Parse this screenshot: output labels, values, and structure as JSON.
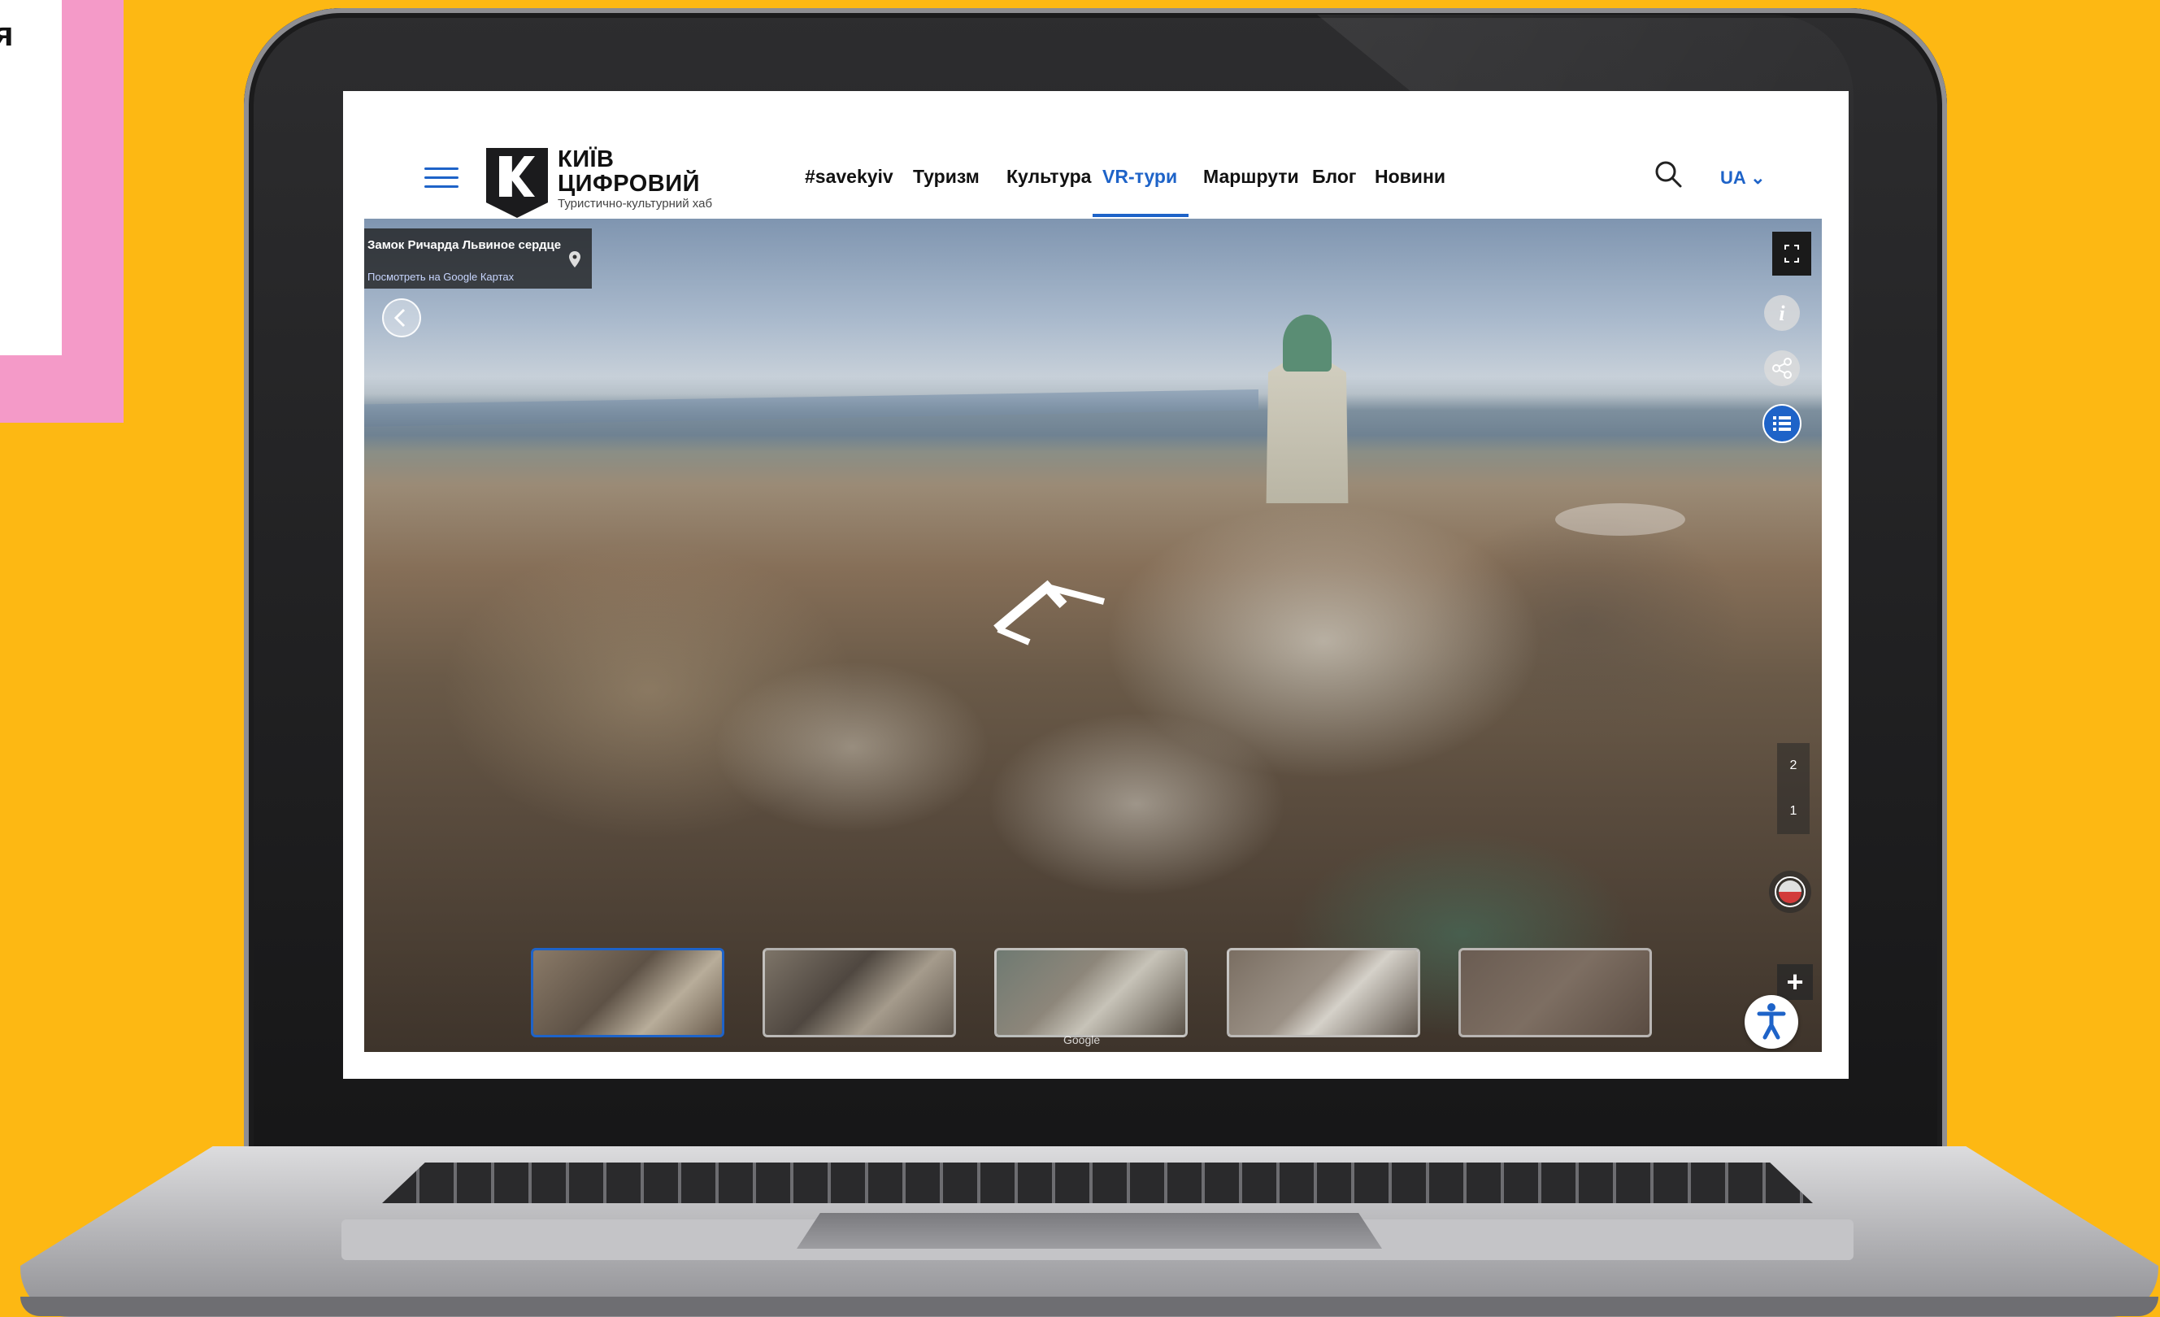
{
  "corner_card": {
    "text": "я"
  },
  "header": {
    "logo": {
      "line1": "КИЇВ",
      "line2": "ЦИФРОВИЙ",
      "subtitle": "Туристично-культурний хаб"
    },
    "nav": [
      {
        "label": "#savekyiv",
        "active": false
      },
      {
        "label": "Туризм",
        "active": false
      },
      {
        "label": "Культура",
        "active": false
      },
      {
        "label": "VR-тури",
        "active": true
      },
      {
        "label": "Маршрути",
        "active": false
      },
      {
        "label": "Блог",
        "active": false
      },
      {
        "label": "Новини",
        "active": false
      }
    ],
    "lang": "UA ⌄",
    "icons": {
      "menu": "hamburger-menu-icon",
      "search": "search-icon"
    }
  },
  "panorama": {
    "location_title": "Замок Ричарда Львиное сердце",
    "location_link": "Посмотреть на Google Картах",
    "floors": [
      "2",
      "1"
    ],
    "zoom_in": "+",
    "google": "Google",
    "active_thumbnail": 1,
    "thumbnail_count": 5,
    "icons": [
      "back-arrow-icon",
      "info-icon",
      "share-icon",
      "menu-grid-icon",
      "fullscreen-icon",
      "compass-icon",
      "accessibility-icon",
      "location-pin-icon"
    ]
  },
  "colors": {
    "accent": "#1E63C8",
    "background": "#FDB813",
    "pink": "#F49AC8"
  }
}
